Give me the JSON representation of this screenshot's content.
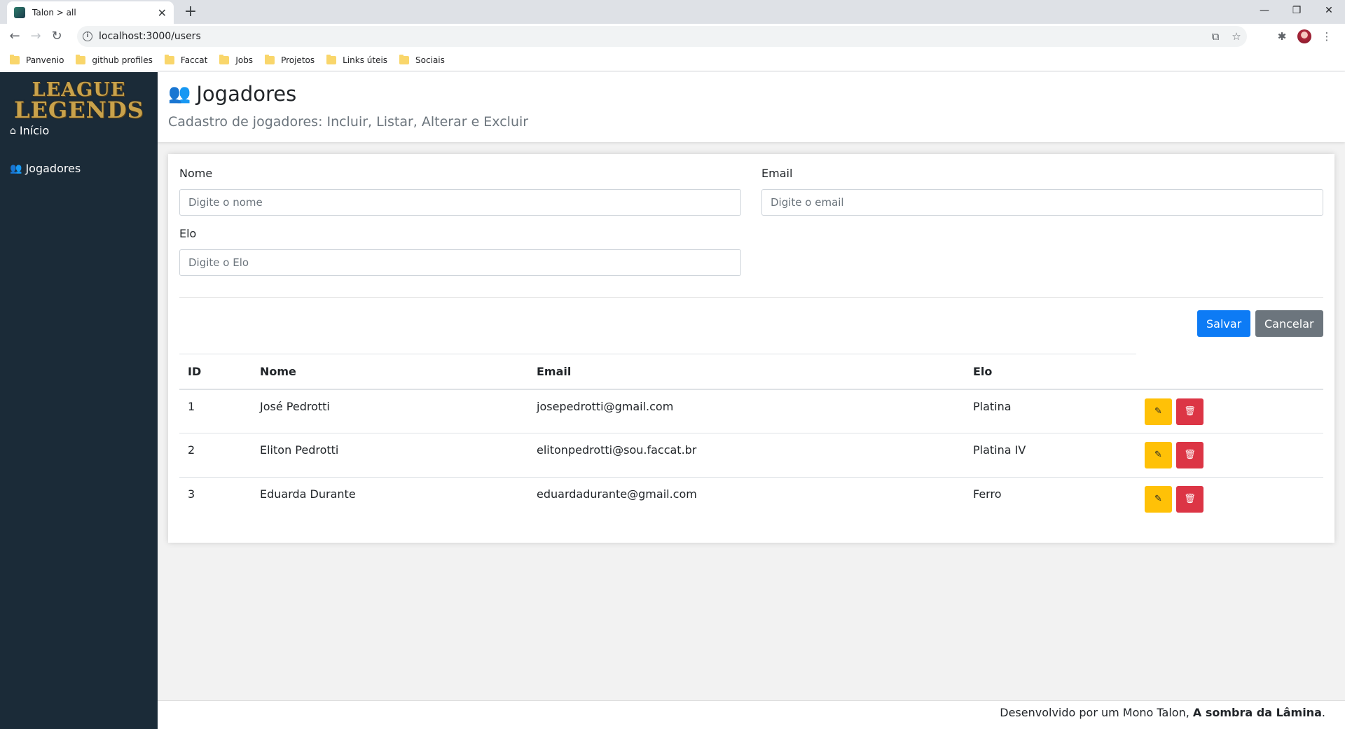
{
  "browser": {
    "tab_title": "Talon > all",
    "url": "localhost:3000/users",
    "bookmarks": [
      "Panvenio",
      "github profiles",
      "Faccat",
      "Jobs",
      "Projetos",
      "Links úteis",
      "Sociais"
    ]
  },
  "sidebar": {
    "logo_line1": "LEAGUE",
    "logo_line2": "LEGENDS",
    "items": [
      {
        "label": "Início",
        "icon": "home-icon"
      },
      {
        "label": "Jogadores",
        "icon": "users-icon"
      }
    ]
  },
  "header": {
    "title": "Jogadores",
    "subtitle": "Cadastro de jogadores: Incluir, Listar, Alterar e Excluir"
  },
  "form": {
    "name_label": "Nome",
    "name_placeholder": "Digite o nome",
    "email_label": "Email",
    "email_placeholder": "Digite o email",
    "elo_label": "Elo",
    "elo_placeholder": "Digite o Elo",
    "save_label": "Salvar",
    "cancel_label": "Cancelar"
  },
  "table": {
    "columns": [
      "ID",
      "Nome",
      "Email",
      "Elo"
    ],
    "rows": [
      {
        "id": "1",
        "name": "José Pedrotti",
        "email": "josepedrotti@gmail.com",
        "elo": "Platina"
      },
      {
        "id": "2",
        "name": "Eliton Pedrotti",
        "email": "elitonpedrotti@sou.faccat.br",
        "elo": "Platina IV"
      },
      {
        "id": "3",
        "name": "Eduarda Durante",
        "email": "eduardadurante@gmail.com",
        "elo": "Ferro"
      }
    ]
  },
  "footer": {
    "text": "Desenvolvido por um Mono Talon, ",
    "bold": "A sombra da Lâmina",
    "end": "."
  },
  "colors": {
    "sidebar_bg": "#1b2b38",
    "primary": "#0d7bf5",
    "secondary": "#6c757d",
    "warning": "#ffc107",
    "danger": "#dc3545"
  }
}
